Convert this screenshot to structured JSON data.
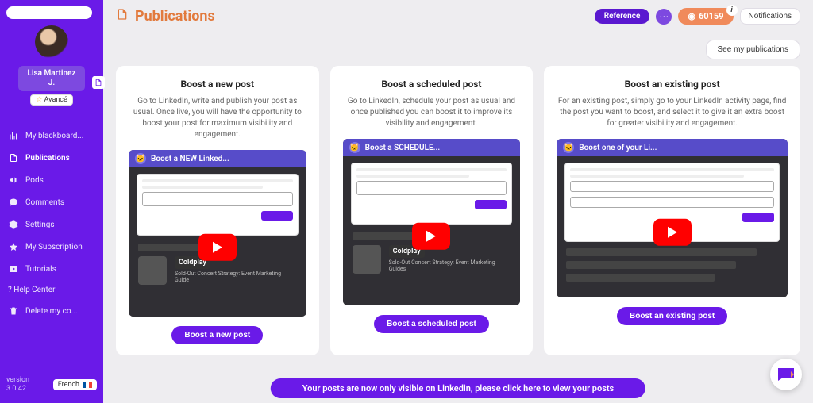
{
  "sidebar": {
    "user": {
      "first": "Lisa",
      "last": "Martinez",
      "suffix": "J.",
      "level_label": "Avancé"
    },
    "items": [
      {
        "label": "My blackboard...",
        "icon": "bar-chart-icon"
      },
      {
        "label": "Publications",
        "icon": "document-icon"
      },
      {
        "label": "Pods",
        "icon": "megaphone-icon"
      },
      {
        "label": "Comments",
        "icon": "chat-icon"
      },
      {
        "label": "Settings",
        "icon": "gear-icon"
      },
      {
        "label": "My Subscription",
        "icon": "star-icon"
      },
      {
        "label": "Tutorials",
        "icon": "play-square-icon"
      },
      {
        "label": "? Help Center",
        "icon": "help-icon"
      },
      {
        "label": "Delete my co...",
        "icon": "trash-icon"
      }
    ],
    "version_label": "version",
    "version": "3.0.42",
    "language": "French"
  },
  "header": {
    "title": "Publications",
    "reference_label": "Reference",
    "score": "60159",
    "notifications_label": "Notifications",
    "see_my_label": "See my publications"
  },
  "cards": [
    {
      "title": "Boost a new post",
      "desc": "Go to LinkedIn, write and publish your post as usual. Once live, you will have the opportunity to boost your post for maximum visibility and engagement.",
      "video_title": "Boost a NEW Linked...",
      "button": "Boost a new post",
      "feed_title": "Coldplay",
      "feed_sub": "Sold-Out Concert Strategy: Event Marketing Guide"
    },
    {
      "title": "Boost a scheduled post",
      "desc": "Go to LinkedIn, schedule your post as usual and once published you can boost it to improve its visibility and engagement.",
      "video_title": "Boost a SCHEDULE...",
      "button": "Boost a scheduled post",
      "feed_title": "Coldplay",
      "feed_sub": "Sold-Out Concert Strategy: Event Marketing Guides"
    },
    {
      "title": "Boost an existing post",
      "desc": "For an existing post, simply go to your LinkedIn activity page, find the post you want to boost, and select it to give it an extra boost for greater visibility and engagement.",
      "video_title": "Boost one of your Li...",
      "button": "Boost an existing post",
      "feed_title": "",
      "feed_sub": ""
    }
  ],
  "banner": "Your posts are now only visible on Linkedin, please click here to view your posts"
}
